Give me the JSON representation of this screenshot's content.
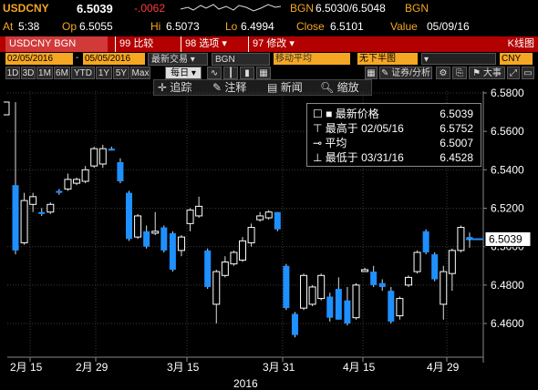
{
  "quote": {
    "ticker": "USDCNY",
    "last": "6.5039",
    "change": "-.0062",
    "bid_ask_label": "BGN",
    "bid_ask": "6.5030/6.5048",
    "bid_ask_source": "BGN",
    "at_label": "At",
    "at_time": "5:38",
    "op_label": "Op",
    "op": "6.5055",
    "hi_label": "Hi",
    "hi": "6.5073",
    "lo_label": "Lo",
    "lo": "6.4994",
    "close_label": "Close",
    "close": "6.5101",
    "value_label": "Value",
    "value_date": "05/09/16"
  },
  "menu": {
    "security": "USDCNY BGN Curncy",
    "items": [
      {
        "num": "99",
        "label": "比较"
      },
      {
        "num": "98",
        "label": "选项"
      },
      {
        "num": "97",
        "label": "修改"
      }
    ],
    "chart_type": "K线图"
  },
  "toolbar": {
    "date_from": "02/05/2016",
    "date_to": "05/05/2016",
    "price_field": "最新交易",
    "periods": [
      "1D",
      "3D",
      "1M",
      "6M",
      "YTD",
      "1Y",
      "5Y",
      "Max"
    ],
    "frequency": "每日",
    "source": "BGN",
    "ma_label": "移动平均",
    "pos_label": "无下半图",
    "currency": "CNY",
    "events_label": "证券/分析",
    "size_label": "大事"
  },
  "chart_tools": [
    {
      "icon": "crosshair-icon",
      "label": "追踪"
    },
    {
      "icon": "pencil-icon",
      "label": "注释"
    },
    {
      "icon": "news-icon",
      "label": "新闻"
    },
    {
      "icon": "zoom-icon",
      "label": "缩放"
    }
  ],
  "legend": {
    "rows": [
      {
        "label": "最新价格",
        "value": "6.5039"
      },
      {
        "label": "最高于 02/05/16",
        "value": "6.5752"
      },
      {
        "label": "平均",
        "value": "6.5007"
      },
      {
        "label": "最低于 03/31/16",
        "value": "6.4528"
      }
    ]
  },
  "colors": {
    "accent": "#f5a623",
    "negative": "#ff3b3b",
    "down_candle": "#1e90ff",
    "up_candle": "#ffffff",
    "menu_bar": "#b30000"
  },
  "chart_data": {
    "type": "candlestick",
    "year_label": "2016",
    "x_ticks": [
      "2月 15",
      "2月 29",
      "3月 15",
      "3月 31",
      "4月 15",
      "4月 29"
    ],
    "y_ticks": [
      "6.5800",
      "6.5600",
      "6.5400",
      "6.5200",
      "6.5000",
      "6.4800",
      "6.4600"
    ],
    "ylim": [
      6.44,
      6.59
    ],
    "last_price_label": "6.5039",
    "candles": [
      {
        "o": 6.532,
        "h": 6.5752,
        "l": 6.496,
        "c": 6.498
      },
      {
        "o": 6.502,
        "h": 6.528,
        "l": 6.501,
        "c": 6.524
      },
      {
        "o": 6.522,
        "h": 6.528,
        "l": 6.518,
        "c": 6.526
      },
      {
        "o": 6.518,
        "h": 6.52,
        "l": 6.516,
        "c": 6.517
      },
      {
        "o": 6.518,
        "h": 6.523,
        "l": 6.517,
        "c": 6.522
      },
      {
        "o": 6.529,
        "h": 6.53,
        "l": 6.527,
        "c": 6.528
      },
      {
        "o": 6.53,
        "h": 6.538,
        "l": 6.529,
        "c": 6.535
      },
      {
        "o": 6.533,
        "h": 6.536,
        "l": 6.532,
        "c": 6.535
      },
      {
        "o": 6.534,
        "h": 6.542,
        "l": 6.533,
        "c": 6.54
      },
      {
        "o": 6.542,
        "h": 6.552,
        "l": 6.541,
        "c": 6.551
      },
      {
        "o": 6.543,
        "h": 6.553,
        "l": 6.541,
        "c": 6.551
      },
      {
        "o": 6.551,
        "h": 6.552,
        "l": 6.55,
        "c": 6.55
      },
      {
        "o": 6.544,
        "h": 6.546,
        "l": 6.533,
        "c": 6.534
      },
      {
        "o": 6.528,
        "h": 6.529,
        "l": 6.503,
        "c": 6.504
      },
      {
        "o": 6.505,
        "h": 6.517,
        "l": 6.504,
        "c": 6.516
      },
      {
        "o": 6.508,
        "h": 6.511,
        "l": 6.499,
        "c": 6.5
      },
      {
        "o": 6.507,
        "h": 6.518,
        "l": 6.506,
        "c": 6.508
      },
      {
        "o": 6.51,
        "h": 6.511,
        "l": 6.497,
        "c": 6.498
      },
      {
        "o": 6.507,
        "h": 6.508,
        "l": 6.487,
        "c": 6.488
      },
      {
        "o": 6.498,
        "h": 6.506,
        "l": 6.495,
        "c": 6.505
      },
      {
        "o": 6.512,
        "h": 6.52,
        "l": 6.508,
        "c": 6.519
      },
      {
        "o": 6.516,
        "h": 6.526,
        "l": 6.515,
        "c": 6.521
      },
      {
        "o": 6.498,
        "h": 6.499,
        "l": 6.478,
        "c": 6.479
      },
      {
        "o": 6.47,
        "h": 6.488,
        "l": 6.46,
        "c": 6.487
      },
      {
        "o": 6.485,
        "h": 6.495,
        "l": 6.484,
        "c": 6.492
      },
      {
        "o": 6.491,
        "h": 6.498,
        "l": 6.49,
        "c": 6.497
      },
      {
        "o": 6.493,
        "h": 6.505,
        "l": 6.492,
        "c": 6.503
      },
      {
        "o": 6.502,
        "h": 6.512,
        "l": 6.5,
        "c": 6.51
      },
      {
        "o": 6.514,
        "h": 6.518,
        "l": 6.513,
        "c": 6.516
      },
      {
        "o": 6.515,
        "h": 6.519,
        "l": 6.514,
        "c": 6.518
      },
      {
        "o": 6.518,
        "h": 6.518,
        "l": 6.508,
        "c": 6.509
      },
      {
        "o": 6.49,
        "h": 6.491,
        "l": 6.467,
        "c": 6.468
      },
      {
        "o": 6.465,
        "h": 6.466,
        "l": 6.4528,
        "c": 6.454
      },
      {
        "o": 6.468,
        "h": 6.486,
        "l": 6.467,
        "c": 6.485
      },
      {
        "o": 6.47,
        "h": 6.48,
        "l": 6.469,
        "c": 6.479
      },
      {
        "o": 6.473,
        "h": 6.486,
        "l": 6.472,
        "c": 6.485
      },
      {
        "o": 6.474,
        "h": 6.476,
        "l": 6.461,
        "c": 6.463
      },
      {
        "o": 6.478,
        "h": 6.484,
        "l": 6.462,
        "c": 6.462
      },
      {
        "o": 6.472,
        "h": 6.479,
        "l": 6.459,
        "c": 6.46
      },
      {
        "o": 6.463,
        "h": 6.481,
        "l": 6.462,
        "c": 6.48
      },
      {
        "o": 6.488,
        "h": 6.489,
        "l": 6.487,
        "c": 6.488
      },
      {
        "o": 6.487,
        "h": 6.49,
        "l": 6.479,
        "c": 6.48
      },
      {
        "o": 6.481,
        "h": 6.483,
        "l": 6.477,
        "c": 6.479
      },
      {
        "o": 6.477,
        "h": 6.479,
        "l": 6.46,
        "c": 6.461
      },
      {
        "o": 6.464,
        "h": 6.474,
        "l": 6.462,
        "c": 6.473
      },
      {
        "o": 6.48,
        "h": 6.485,
        "l": 6.479,
        "c": 6.484
      },
      {
        "o": 6.487,
        "h": 6.498,
        "l": 6.486,
        "c": 6.497
      },
      {
        "o": 6.508,
        "h": 6.509,
        "l": 6.496,
        "c": 6.497
      },
      {
        "o": 6.496,
        "h": 6.497,
        "l": 6.482,
        "c": 6.483
      },
      {
        "o": 6.47,
        "h": 6.49,
        "l": 6.462,
        "c": 6.487
      },
      {
        "o": 6.486,
        "h": 6.499,
        "l": 6.477,
        "c": 6.498
      },
      {
        "o": 6.498,
        "h": 6.511,
        "l": 6.497,
        "c": 6.51
      },
      {
        "o": 6.505,
        "h": 6.5073,
        "l": 6.4994,
        "c": 6.5039
      }
    ]
  }
}
